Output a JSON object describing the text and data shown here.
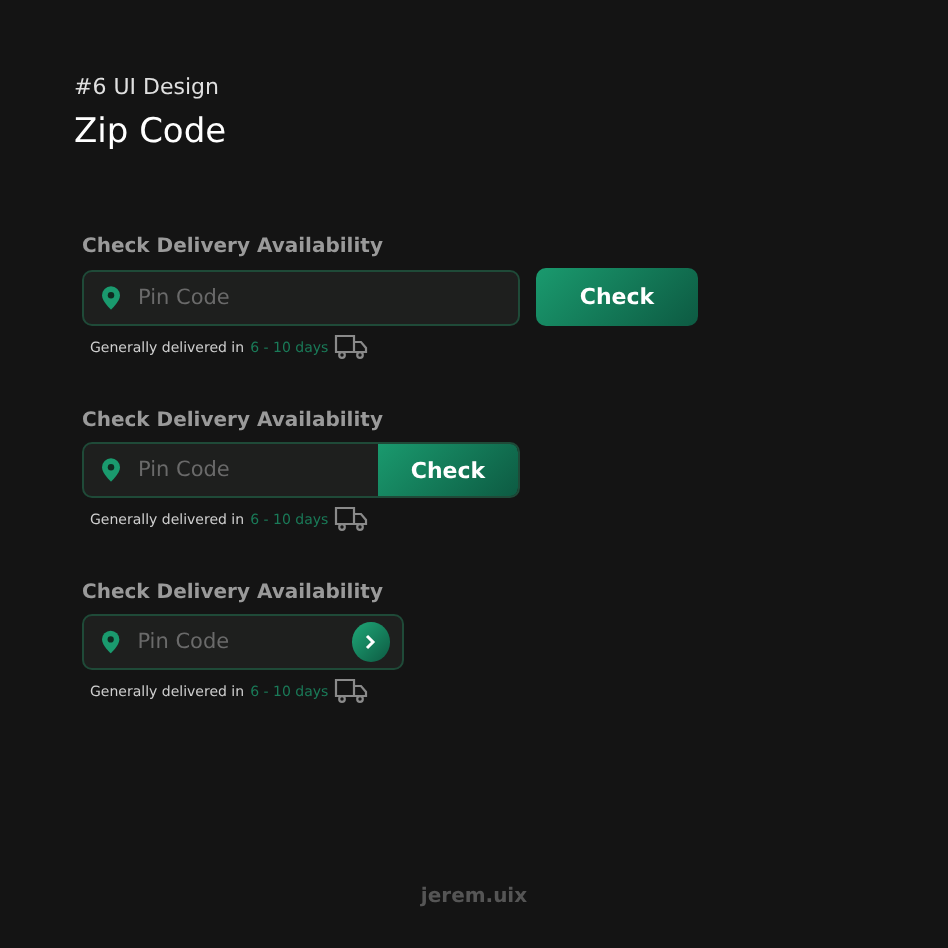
{
  "header": {
    "series": "#6 UI Design",
    "title": "Zip Code"
  },
  "sections": [
    {
      "kind": "separate",
      "label": "Check Delivery Availability",
      "placeholder": "Pin Code",
      "button": "Check",
      "note": "Generally delivered in",
      "days": "6 - 10 days"
    },
    {
      "kind": "attached",
      "label": "Check Delivery Availability",
      "placeholder": "Pin Code",
      "button": "Check",
      "note": "Generally delivered in",
      "days": "6 - 10 days"
    },
    {
      "kind": "icon",
      "label": "Check Delivery Availability",
      "placeholder": "Pin Code",
      "note": "Generally delivered in",
      "days": "6 - 10 days"
    }
  ],
  "credit": "jerem.uix"
}
